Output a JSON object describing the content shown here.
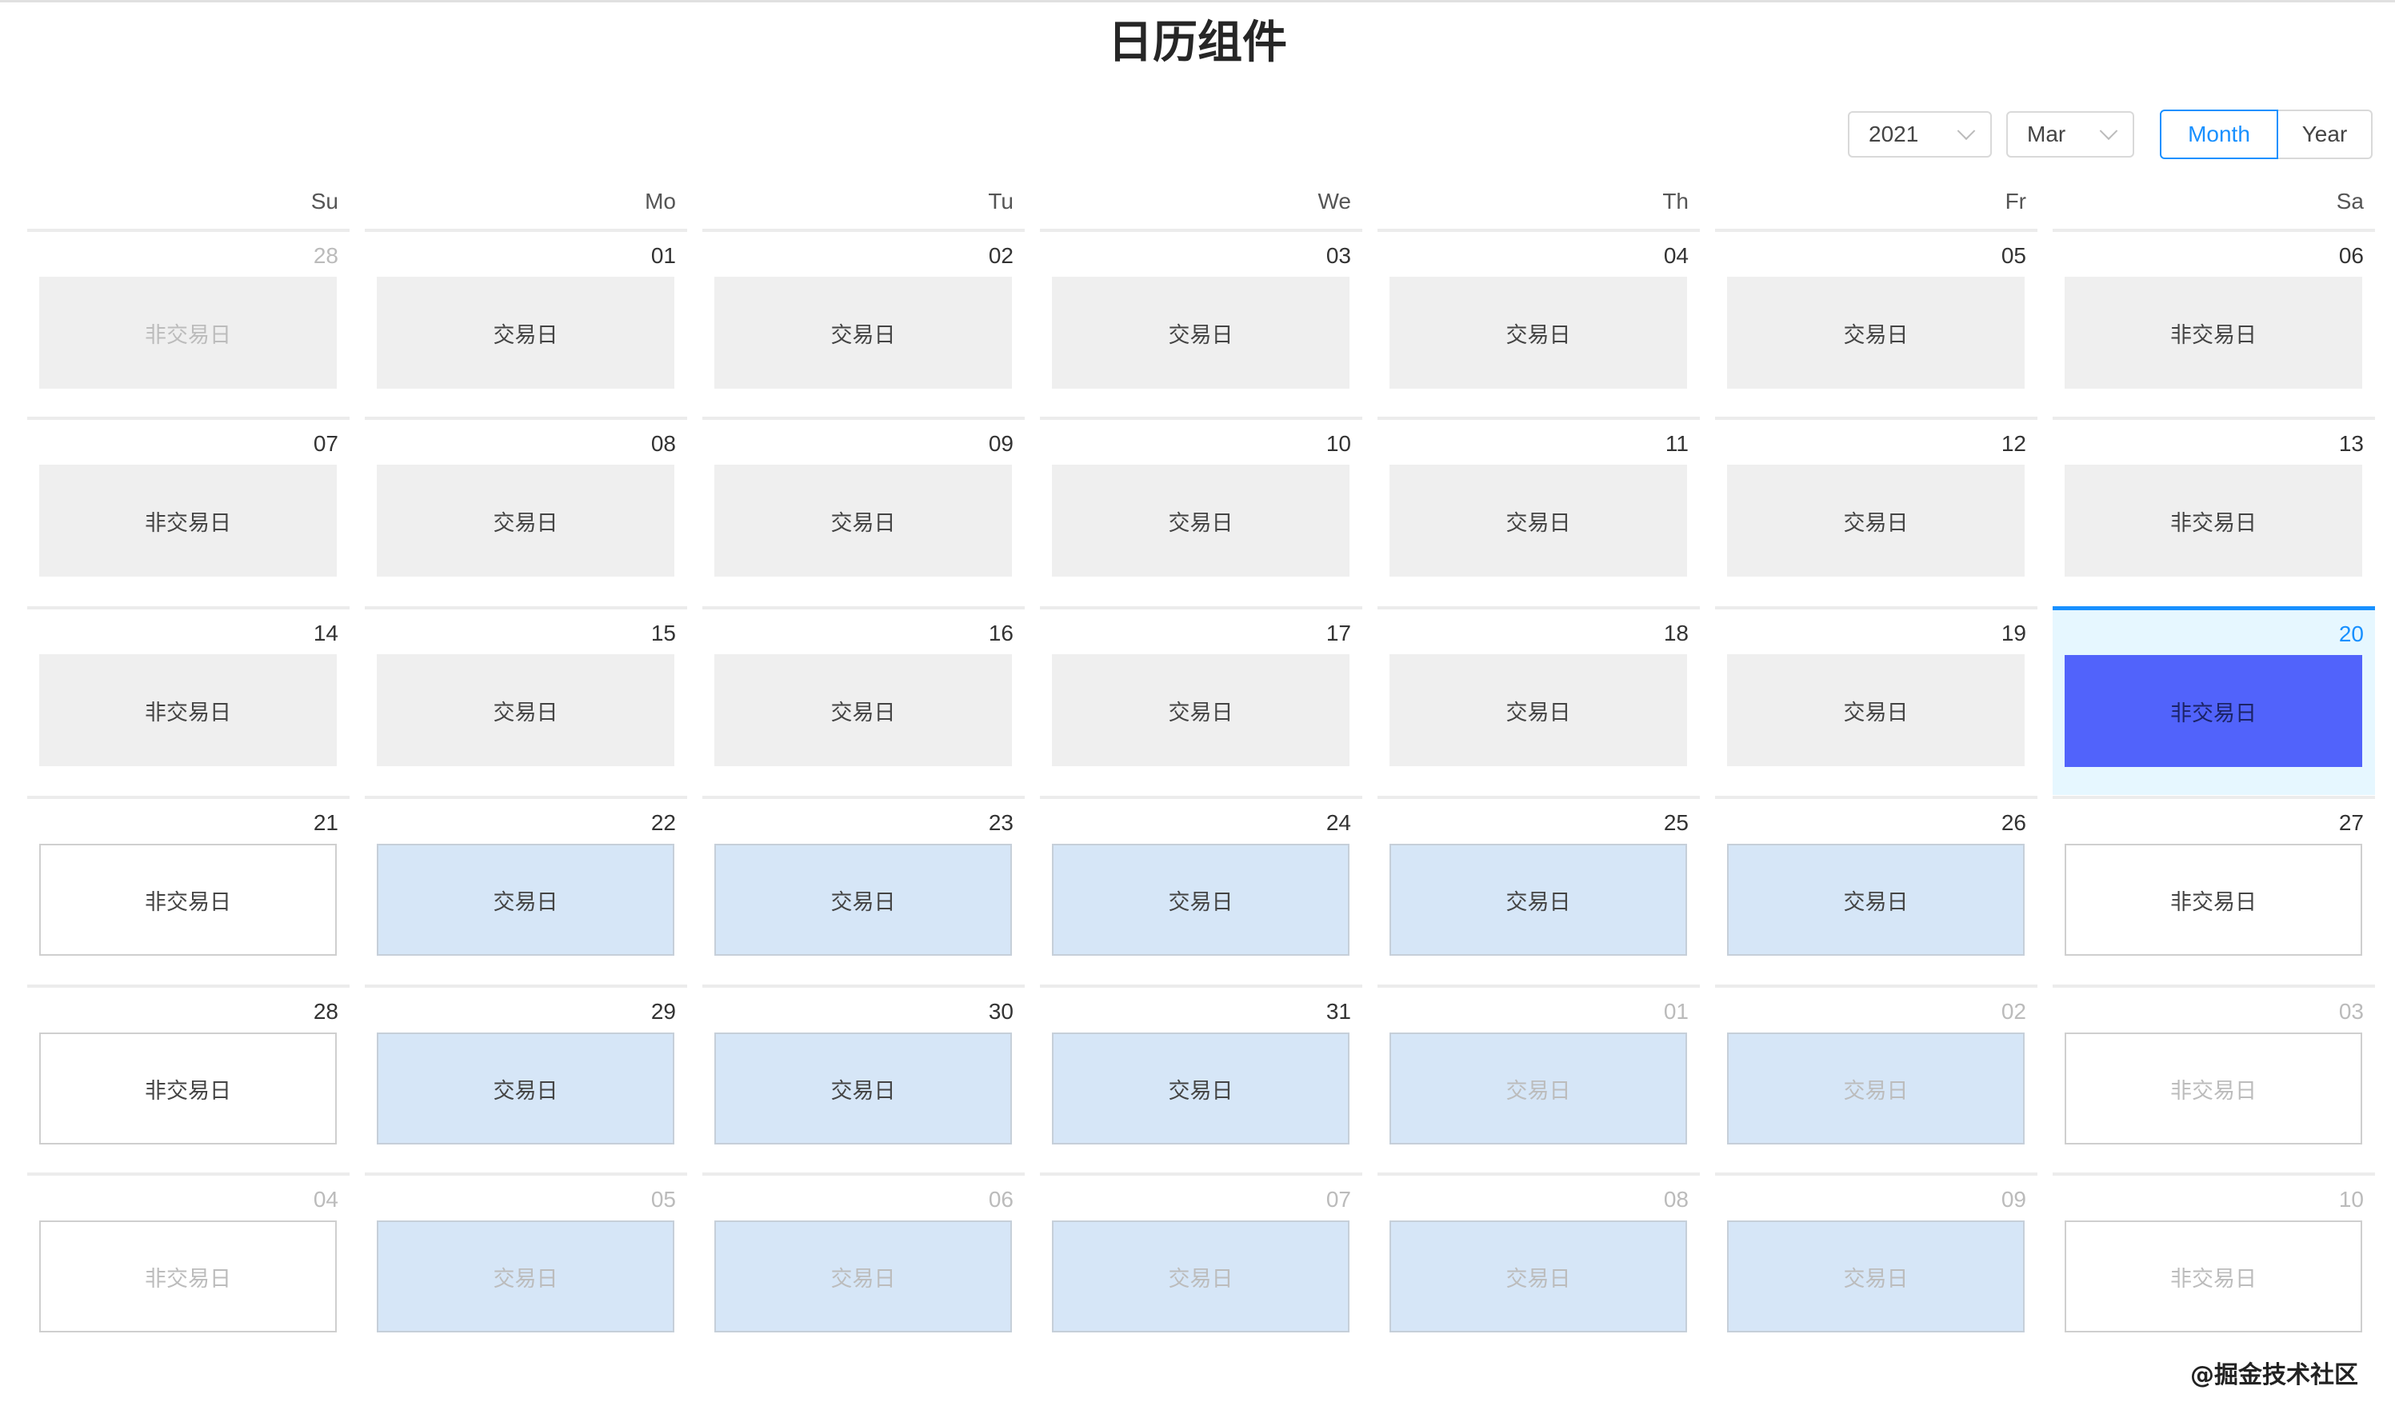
{
  "title": "日历组件",
  "controls": {
    "year_value": "2021",
    "month_value": "Mar",
    "mode_buttons": [
      {
        "label": "Month",
        "active": true
      },
      {
        "label": "Year",
        "active": false
      }
    ]
  },
  "weekdays": [
    "Su",
    "Mo",
    "Tu",
    "We",
    "Th",
    "Fr",
    "Sa"
  ],
  "labels": {
    "trading": "交易日",
    "non_trading": "非交易日"
  },
  "colors": {
    "accent": "#1890ff",
    "selected_fill": "#5163fb",
    "selected_row_bg": "#e6f7ff",
    "past_fill": "#efefef",
    "trading_fill": "#d6e6f7"
  },
  "weeks": [
    [
      {
        "date": "28",
        "label": "非交易日",
        "style": "gray",
        "other": true
      },
      {
        "date": "01",
        "label": "交易日",
        "style": "gray"
      },
      {
        "date": "02",
        "label": "交易日",
        "style": "gray"
      },
      {
        "date": "03",
        "label": "交易日",
        "style": "gray"
      },
      {
        "date": "04",
        "label": "交易日",
        "style": "gray"
      },
      {
        "date": "05",
        "label": "交易日",
        "style": "gray"
      },
      {
        "date": "06",
        "label": "非交易日",
        "style": "gray"
      }
    ],
    [
      {
        "date": "07",
        "label": "非交易日",
        "style": "gray"
      },
      {
        "date": "08",
        "label": "交易日",
        "style": "gray"
      },
      {
        "date": "09",
        "label": "交易日",
        "style": "gray"
      },
      {
        "date": "10",
        "label": "交易日",
        "style": "gray"
      },
      {
        "date": "11",
        "label": "交易日",
        "style": "gray"
      },
      {
        "date": "12",
        "label": "交易日",
        "style": "gray"
      },
      {
        "date": "13",
        "label": "非交易日",
        "style": "gray"
      }
    ],
    [
      {
        "date": "14",
        "label": "非交易日",
        "style": "gray"
      },
      {
        "date": "15",
        "label": "交易日",
        "style": "gray"
      },
      {
        "date": "16",
        "label": "交易日",
        "style": "gray"
      },
      {
        "date": "17",
        "label": "交易日",
        "style": "gray"
      },
      {
        "date": "18",
        "label": "交易日",
        "style": "gray"
      },
      {
        "date": "19",
        "label": "交易日",
        "style": "gray"
      },
      {
        "date": "20",
        "label": "非交易日",
        "style": "sel",
        "selected": true
      }
    ],
    [
      {
        "date": "21",
        "label": "非交易日",
        "style": "white"
      },
      {
        "date": "22",
        "label": "交易日",
        "style": "blue"
      },
      {
        "date": "23",
        "label": "交易日",
        "style": "blue"
      },
      {
        "date": "24",
        "label": "交易日",
        "style": "blue"
      },
      {
        "date": "25",
        "label": "交易日",
        "style": "blue"
      },
      {
        "date": "26",
        "label": "交易日",
        "style": "blue"
      },
      {
        "date": "27",
        "label": "非交易日",
        "style": "white"
      }
    ],
    [
      {
        "date": "28",
        "label": "非交易日",
        "style": "white"
      },
      {
        "date": "29",
        "label": "交易日",
        "style": "blue"
      },
      {
        "date": "30",
        "label": "交易日",
        "style": "blue"
      },
      {
        "date": "31",
        "label": "交易日",
        "style": "blue"
      },
      {
        "date": "01",
        "label": "交易日",
        "style": "blue",
        "other": true
      },
      {
        "date": "02",
        "label": "交易日",
        "style": "blue",
        "other": true
      },
      {
        "date": "03",
        "label": "非交易日",
        "style": "white",
        "other": true
      }
    ],
    [
      {
        "date": "04",
        "label": "非交易日",
        "style": "white",
        "other": true
      },
      {
        "date": "05",
        "label": "交易日",
        "style": "blue",
        "other": true
      },
      {
        "date": "06",
        "label": "交易日",
        "style": "blue",
        "other": true
      },
      {
        "date": "07",
        "label": "交易日",
        "style": "blue",
        "other": true
      },
      {
        "date": "08",
        "label": "交易日",
        "style": "blue",
        "other": true
      },
      {
        "date": "09",
        "label": "交易日",
        "style": "blue",
        "other": true
      },
      {
        "date": "10",
        "label": "非交易日",
        "style": "white",
        "other": true
      }
    ]
  ],
  "watermark": "@掘金技术社区"
}
